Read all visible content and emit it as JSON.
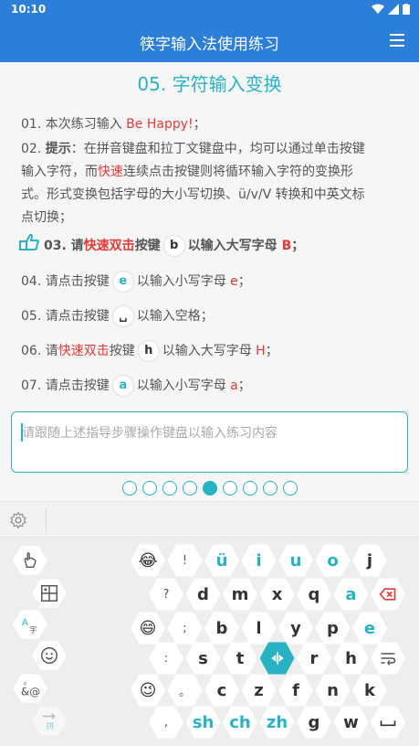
{
  "status": {
    "time": "10:10"
  },
  "app": {
    "title": "筷字输入法使用练习",
    "menu_icon": "hamburger-menu-icon"
  },
  "lesson": {
    "title": "05. 字符输入变换",
    "steps": {
      "s01": {
        "prefix": "01. 本次练习输入 ",
        "highlight": "Be Happy!",
        "suffix": "；"
      },
      "s02": {
        "num": "02. ",
        "label": "提示",
        "text1": "：在拼音键盘和拉丁文键盘中，均可以通过单击按键",
        "text2": "输入字符，而",
        "highlight": "快速",
        "text3": "连续点击按键则将循环输入字符的变换形",
        "text4": "式。形式变换包括字母的大小写切换、ü/v/V 转换和中英文标",
        "text5": "点切换；"
      },
      "s03": {
        "prefix": "03. 请",
        "highlight": "快速双击",
        "mid": "按键",
        "key": "b",
        "suffix": "以输入大写字母 ",
        "letter": "B",
        "end": "；"
      },
      "s04": {
        "prefix": "04. 请点击按键",
        "key": "e",
        "suffix": "以输入小写字母 ",
        "letter": "e",
        "end": "；"
      },
      "s05": {
        "prefix": "05. 请点击按键",
        "key": "␣",
        "suffix": "以输入空格；"
      },
      "s06": {
        "prefix": "06. 请",
        "highlight": "快速双击",
        "mid": "按键",
        "key": "h",
        "suffix": "以输入大写字母 ",
        "letter": "H",
        "end": "；"
      },
      "s07": {
        "prefix": "07. 请点击按键",
        "key": "a",
        "suffix": "以输入小写字母 ",
        "letter": "a",
        "end": "；"
      }
    }
  },
  "input": {
    "placeholder": "请跟随上述指导步骤操作键盘以输入练习内容",
    "value": ""
  },
  "pager": {
    "total": 9,
    "current": 5
  },
  "keyboard": {
    "row1": [
      "😂",
      "!",
      "ü",
      "i",
      "u",
      "o",
      "j"
    ],
    "row2": [
      "?",
      "d",
      "m",
      "x",
      "q",
      "a",
      "backspace"
    ],
    "row3": [
      "😄",
      ";",
      "b",
      "l",
      "y",
      "p",
      "e"
    ],
    "row4": [
      ":",
      "s",
      "t",
      "enter",
      "r",
      "h",
      "wrap"
    ],
    "row5": [
      "😉",
      "。",
      "c",
      "z",
      "f",
      "n",
      "k"
    ],
    "row6": [
      ",",
      "sh",
      "ch",
      "zh",
      "g",
      "w",
      "space"
    ],
    "side": [
      "hand-gesture-icon",
      "keyboard-grid-icon",
      "translate-icon",
      "emoji-icon",
      "symbol-icon",
      "pinyin-switch-icon"
    ],
    "colors": {
      "accent": "#27b3c4",
      "red": "#e53935"
    }
  }
}
